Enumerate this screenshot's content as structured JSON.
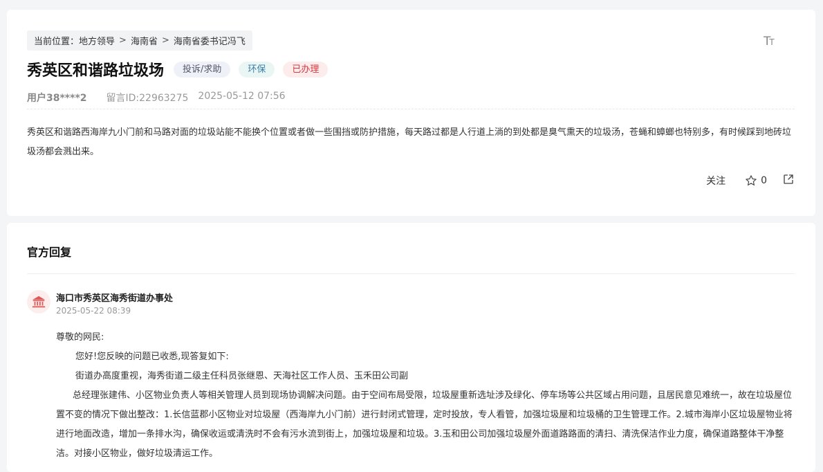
{
  "breadcrumb": {
    "prefix": "当前位置：",
    "items": [
      "地方领导",
      "海南省",
      "海南省委书记冯飞"
    ],
    "separator": ">"
  },
  "font_toggle": {
    "big": "T",
    "small": "T"
  },
  "post": {
    "title": "秀英区和谐路垃圾场",
    "tags": {
      "type": "投诉/求助",
      "topic": "环保",
      "status": "已办理"
    },
    "user": "用户38****2",
    "message_id": "留言ID:22963275",
    "time": "2025-05-12 07:56",
    "content": "秀英区和谐路西海岸九小门前和马路对面的垃圾站能不能换个位置或者做一些围挡或防护措施，每天路过都是人行道上淌的到处都是臭气熏天的垃圾汤，苍蝇和蟑螂也特别多，有时候踩到地砖垃圾汤都会溅出来。"
  },
  "actions": {
    "follow": "关注",
    "star_count": "0"
  },
  "reply": {
    "section_title": "官方回复",
    "org_name": "海口市秀英区海秀街道办事处",
    "time": "2025-05-22 08:39",
    "greeting": "尊敬的网民:",
    "line1": "您好!您反映的问题已收悉,现答复如下:",
    "line2": "街道办高度重视，海秀街道二级主任科员张继恩、天海社区工作人员、玉禾田公司副",
    "line3": "总经理张建伟、小区物业负责人等相关管理人员到现场协调解决问题。由于空间布局受限，垃圾屋重新选址涉及绿化、停车场等公共区域占用问题，且居民意见难统一，故在垃圾屋位置不变的情况下做出整改：1.长信蓝郡小区物业对垃圾屋（西海岸九小门前）进行封闭式管理，定时投放，专人看管，加强垃圾屋和垃圾桶的卫生管理工作。2.城市海岸小区垃圾屋物业将进行地面改造，增加一条排水沟，确保收运或清洗时不会有污水流到街上，加强垃圾屋和垃圾。3.玉和田公司加强垃圾屋外面道路路面的清扫、清洗保洁作业力度，确保道路整体干净整洁。对接小区物业，做好垃圾清运工作。"
  }
}
